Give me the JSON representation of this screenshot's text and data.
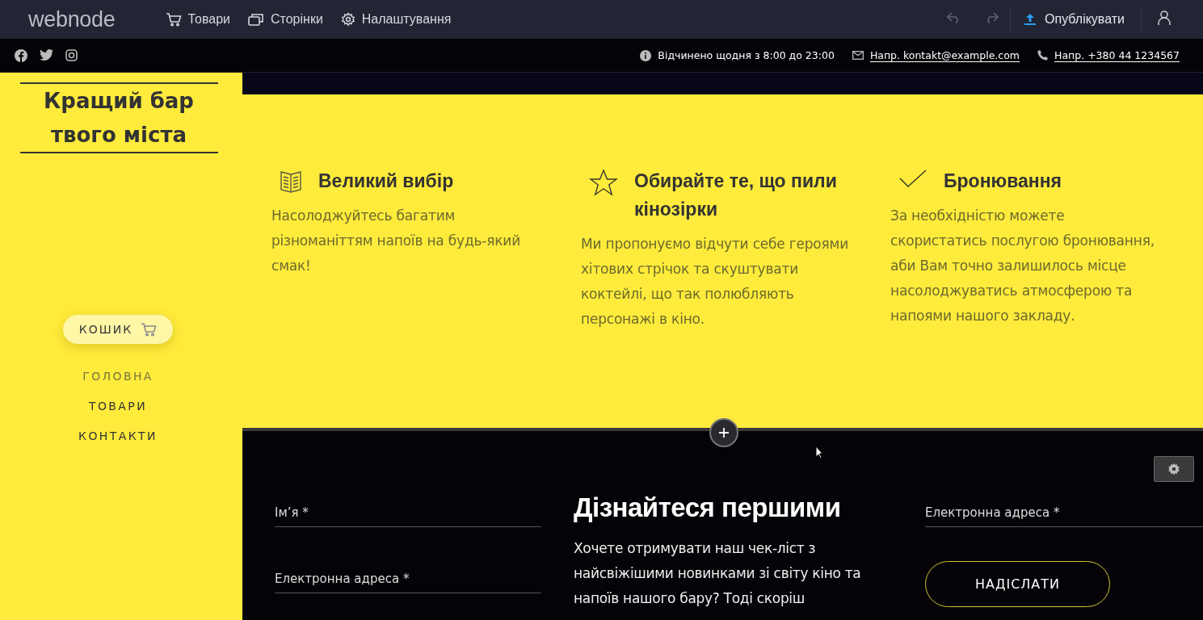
{
  "editor_bar": {
    "logo": "webnode",
    "menu": [
      {
        "label": "Товари",
        "kind": "cart"
      },
      {
        "label": "Сторінки",
        "kind": "pages"
      },
      {
        "label": "Налаштування",
        "kind": "gear"
      }
    ],
    "publish": "Опублікувати"
  },
  "info_bar": {
    "hours": "Відчинено щодня з 8:00 до 23:00",
    "email": "Напр. kontakt@example.com",
    "phone": "Напр. +380 44 1234567"
  },
  "sidebar": {
    "title": "Кращий бар твого міста",
    "cart_button": "КОШИК",
    "nav": [
      {
        "label": "ГОЛОВНА",
        "selected": true
      },
      {
        "label": "ТОВАРИ",
        "selected": false
      },
      {
        "label": "КОНТАКТИ",
        "selected": false
      }
    ]
  },
  "features": [
    {
      "kind": "book",
      "title": "Великий вибір",
      "text": "Насолоджуйтесь багатим різноманіттям напоїв на будь-який смак!"
    },
    {
      "kind": "star",
      "title": "Обирайте те, що пили кінозірки",
      "text": "Ми пропонуємо відчути себе героями хітових стрічок та скуштувати коктейлі, що так полюбляють персонажі в кіно."
    },
    {
      "kind": "check",
      "title": "Бронювання",
      "text": "За необхідністю можете скористатись послугою бронювання, аби Вам точно залишилось місце насолоджуватись атмосферою та напоями нашого закладу."
    }
  ],
  "signup": {
    "fields_left": [
      {
        "placeholder": "Ім’я *"
      },
      {
        "placeholder": "Електронна адреса *"
      }
    ],
    "title": "Дізнайтеся першими",
    "text": "Хочете отримувати наш чек-ліст з найсвіжішими новинками зі світу кіно та напоїв нашого бару? Тоді скоріш",
    "fields_right": [
      {
        "placeholder": "Електронна адреса *"
      }
    ],
    "button": "НАДІСЛАТИ"
  }
}
